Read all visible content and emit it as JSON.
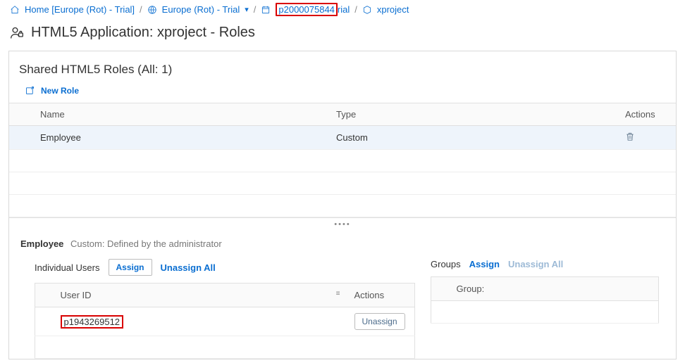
{
  "breadcrumb": {
    "home": "Home [Europe (Rot) - Trial]",
    "region": "Europe (Rot) - Trial",
    "account_id": "p2000075844",
    "account_overlay_suffix": "rial",
    "app": "xproject"
  },
  "page_title": "HTML5 Application: xproject - Roles",
  "roles_section": {
    "title": "Shared HTML5 Roles (All: 1)",
    "new_role_label": "New Role",
    "headers": {
      "name": "Name",
      "type": "Type",
      "actions": "Actions"
    },
    "rows": [
      {
        "name": "Employee",
        "type": "Custom"
      }
    ]
  },
  "role_detail": {
    "name": "Employee",
    "desc": "Custom: Defined by the administrator"
  },
  "users_panel": {
    "tab_label": "Individual Users",
    "assign_label": "Assign",
    "unassign_all_label": "Unassign All",
    "headers": {
      "user_id": "User ID",
      "actions": "Actions"
    },
    "rows": [
      {
        "user_id": "p1943269512",
        "unassign_label": "Unassign"
      }
    ]
  },
  "groups_panel": {
    "tab_label": "Groups",
    "assign_label": "Assign",
    "unassign_all_label": "Unassign All",
    "headers": {
      "group": "Group:"
    }
  }
}
